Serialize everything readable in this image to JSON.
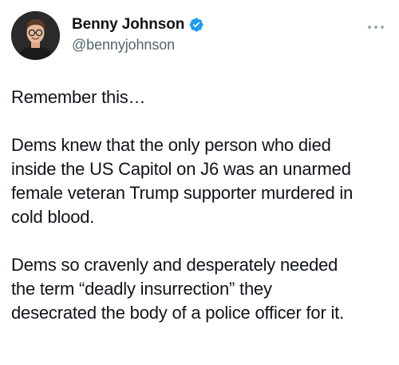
{
  "tweet": {
    "author": {
      "display_name": "Benny Johnson",
      "handle": "@bennyjohnson",
      "verified": true,
      "verified_color": "#1d9bf0"
    },
    "more_icon": "more-horizontal-icon",
    "paragraphs": [
      "Remember this…",
      "Dems knew that the only person who died\ninside the US Capitol on J6 was an unarmed\nfemale veteran Trump supporter murdered in\ncold blood.",
      "Dems so cravenly and desperately needed\nthe term “deadly insurrection” they\ndesecrated the body of a police officer for it."
    ]
  }
}
